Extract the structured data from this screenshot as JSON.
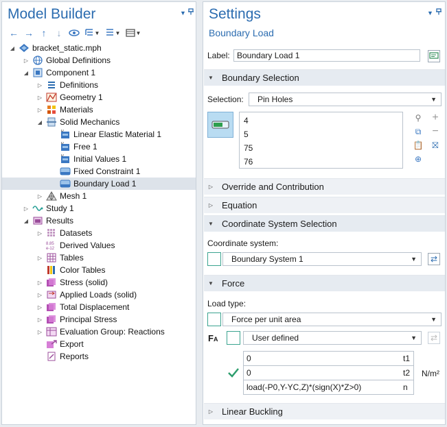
{
  "model_builder": {
    "title": "Model Builder",
    "tree": [
      {
        "label": "bracket_static.mph",
        "icon": "model-file-icon",
        "level": 0,
        "arrow": "open"
      },
      {
        "label": "Global Definitions",
        "icon": "globe-icon",
        "level": 1,
        "arrow": "closed"
      },
      {
        "label": "Component 1",
        "icon": "component-icon",
        "level": 1,
        "arrow": "open"
      },
      {
        "label": "Definitions",
        "icon": "definitions-icon",
        "level": 2,
        "arrow": "closed"
      },
      {
        "label": "Geometry 1",
        "icon": "geometry-icon",
        "level": 2,
        "arrow": "closed"
      },
      {
        "label": "Materials",
        "icon": "materials-icon",
        "level": 2,
        "arrow": "closed"
      },
      {
        "label": "Solid Mechanics",
        "icon": "solid-mechanics-icon",
        "level": 2,
        "arrow": "open"
      },
      {
        "label": "Linear Elastic Material 1",
        "icon": "default-node-icon",
        "level": 3,
        "arrow": "none"
      },
      {
        "label": "Free 1",
        "icon": "default-node-icon",
        "level": 3,
        "arrow": "none"
      },
      {
        "label": "Initial Values 1",
        "icon": "default-node-icon",
        "level": 3,
        "arrow": "none"
      },
      {
        "label": "Fixed Constraint 1",
        "icon": "boundary-icon",
        "level": 3,
        "arrow": "none"
      },
      {
        "label": "Boundary Load 1",
        "icon": "boundary-icon",
        "level": 3,
        "arrow": "none",
        "selected": true
      },
      {
        "label": "Mesh 1",
        "icon": "mesh-icon",
        "level": 2,
        "arrow": "closed"
      },
      {
        "label": "Study 1",
        "icon": "study-icon",
        "level": 1,
        "arrow": "closed"
      },
      {
        "label": "Results",
        "icon": "results-icon",
        "level": 1,
        "arrow": "open"
      },
      {
        "label": "Datasets",
        "icon": "datasets-icon",
        "level": 2,
        "arrow": "closed"
      },
      {
        "label": "Derived Values",
        "icon": "derived-values-icon",
        "level": 2,
        "arrow": "none"
      },
      {
        "label": "Tables",
        "icon": "tables-icon",
        "level": 2,
        "arrow": "closed"
      },
      {
        "label": "Color Tables",
        "icon": "color-tables-icon",
        "level": 2,
        "arrow": "none"
      },
      {
        "label": "Stress (solid)",
        "icon": "plot-group-icon",
        "level": 2,
        "arrow": "closed"
      },
      {
        "label": "Applied Loads (solid)",
        "icon": "applied-loads-icon",
        "level": 2,
        "arrow": "closed"
      },
      {
        "label": "Total Displacement",
        "icon": "plot-group-icon",
        "level": 2,
        "arrow": "closed"
      },
      {
        "label": "Principal Stress",
        "icon": "plot-group-icon",
        "level": 2,
        "arrow": "closed"
      },
      {
        "label": "Evaluation Group: Reactions",
        "icon": "evaluation-group-icon",
        "level": 2,
        "arrow": "closed"
      },
      {
        "label": "Export",
        "icon": "export-icon",
        "level": 2,
        "arrow": "none"
      },
      {
        "label": "Reports",
        "icon": "reports-icon",
        "level": 2,
        "arrow": "none"
      }
    ]
  },
  "settings": {
    "title": "Settings",
    "subtitle": "Boundary Load",
    "label_caption": "Label:",
    "label_value": "Boundary Load 1",
    "sections": {
      "boundary_selection": "Boundary Selection",
      "override": "Override and Contribution",
      "equation": "Equation",
      "coordinate": "Coordinate System Selection",
      "force": "Force",
      "linear_buckling": "Linear Buckling"
    },
    "selection_caption": "Selection:",
    "selection_value": "Pin Holes",
    "boundaries": [
      "4",
      "5",
      "75",
      "76"
    ],
    "coord_caption": "Coordinate system:",
    "coord_value": "Boundary System 1",
    "load_type_caption": "Load type:",
    "load_type_value": "Force per unit area",
    "fa_symbol": "F",
    "fa_subscript": "A",
    "fa_mode": "User defined",
    "components": [
      {
        "value": "0",
        "unit": "t1"
      },
      {
        "value": "0",
        "unit": "t2"
      },
      {
        "value": "load(-P0,Y-YC,Z)*(sign(X)*Z>0)",
        "unit": "n"
      }
    ],
    "force_unit": "N/m²"
  },
  "colors": {
    "accent": "#2b6cb0",
    "selected_row": "#dde3ea",
    "section_bg": "#eef1f5",
    "teal": "#3aa38f"
  }
}
